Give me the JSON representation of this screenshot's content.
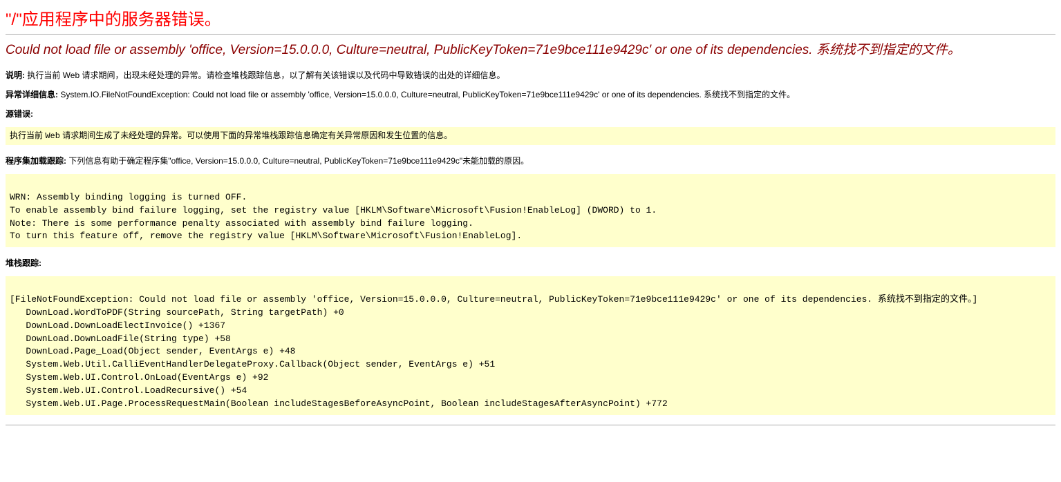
{
  "page_title": "\"/\"应用程序中的服务器错误。",
  "error_message": "Could not load file or assembly 'office, Version=15.0.0.0, Culture=neutral, PublicKeyToken=71e9bce111e9429c' or one of its dependencies. 系统找不到指定的文件。",
  "description": {
    "label": "说明:",
    "text": "执行当前 Web 请求期间，出现未经处理的异常。请检查堆栈跟踪信息，以了解有关该错误以及代码中导致错误的出处的详细信息。"
  },
  "exception_details": {
    "label": "异常详细信息:",
    "text": "System.IO.FileNotFoundException: Could not load file or assembly 'office, Version=15.0.0.0, Culture=neutral, PublicKeyToken=71e9bce111e9429c' or one of its dependencies. 系统找不到指定的文件。"
  },
  "source_error": {
    "label": "源错误:",
    "prefix": "执行当前 ",
    "code_word": "Web",
    "suffix": " 请求期间生成了未经处理的异常。可以使用下面的异常堆栈跟踪信息确定有关异常原因和发生位置的信息。"
  },
  "assembly_load_trace": {
    "label": "程序集加载跟踪:",
    "text": "下列信息有助于确定程序集\"office, Version=15.0.0.0, Culture=neutral, PublicKeyToken=71e9bce111e9429c\"未能加载的原因。",
    "box": "\nWRN: Assembly binding logging is turned OFF.\nTo enable assembly bind failure logging, set the registry value [HKLM\\Software\\Microsoft\\Fusion!EnableLog] (DWORD) to 1.\nNote: There is some performance penalty associated with assembly bind failure logging.\nTo turn this feature off, remove the registry value [HKLM\\Software\\Microsoft\\Fusion!EnableLog].\n"
  },
  "stack_trace": {
    "label": "堆栈跟踪:",
    "box": "\n[FileNotFoundException: Could not load file or assembly 'office, Version=15.0.0.0, Culture=neutral, PublicKeyToken=71e9bce111e9429c' or one of its dependencies. 系统找不到指定的文件。]\n   DownLoad.WordToPDF(String sourcePath, String targetPath) +0\n   DownLoad.DownLoadElectInvoice() +1367\n   DownLoad.DownLoadFile(String type) +58\n   DownLoad.Page_Load(Object sender, EventArgs e) +48\n   System.Web.Util.CalliEventHandlerDelegateProxy.Callback(Object sender, EventArgs e) +51\n   System.Web.UI.Control.OnLoad(EventArgs e) +92\n   System.Web.UI.Control.LoadRecursive() +54\n   System.Web.UI.Page.ProcessRequestMain(Boolean includeStagesBeforeAsyncPoint, Boolean includeStagesAfterAsyncPoint) +772\n"
  }
}
